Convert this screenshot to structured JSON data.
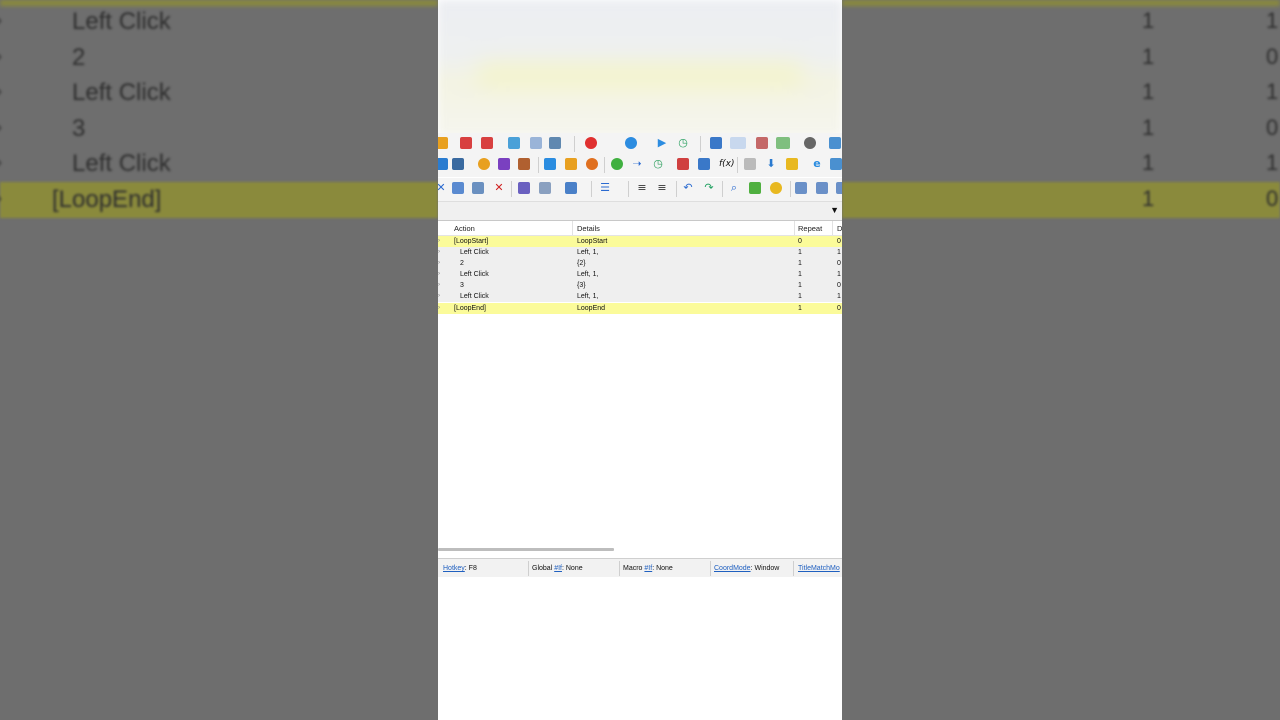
{
  "background_zoom": {
    "rows": [
      {
        "label": "Left Click",
        "repeat": "1",
        "extra": "1",
        "highlight": false
      },
      {
        "label": "2",
        "repeat": "1",
        "extra": "0",
        "highlight": false
      },
      {
        "label": "Left Click",
        "repeat": "1",
        "extra": "1",
        "highlight": false
      },
      {
        "label": "3",
        "repeat": "1",
        "extra": "0",
        "highlight": false
      },
      {
        "label": "Left Click",
        "repeat": "1",
        "extra": "1",
        "highlight": false
      },
      {
        "label": "[LoopEnd]",
        "repeat": "1",
        "extra": "0",
        "highlight": true
      }
    ]
  },
  "list": {
    "columns": {
      "action": "Action",
      "details": "Details",
      "repeat": "Repeat",
      "delay": "D"
    },
    "rows": [
      {
        "action": "[LoopStart]",
        "details": "LoopStart",
        "repeat": "0",
        "delay": "0",
        "highlight": true,
        "indent": false
      },
      {
        "action": "Left Click",
        "details": "Left, 1,",
        "repeat": "1",
        "delay": "1",
        "highlight": false,
        "indent": true
      },
      {
        "action": "2",
        "details": "{2}",
        "repeat": "1",
        "delay": "0",
        "highlight": false,
        "indent": true
      },
      {
        "action": "Left Click",
        "details": "Left, 1,",
        "repeat": "1",
        "delay": "1",
        "highlight": false,
        "indent": true
      },
      {
        "action": "3",
        "details": "{3}",
        "repeat": "1",
        "delay": "0",
        "highlight": false,
        "indent": true
      },
      {
        "action": "Left Click",
        "details": "Left, 1,",
        "repeat": "1",
        "delay": "1",
        "highlight": false,
        "indent": true
      },
      {
        "action": "[LoopEnd]",
        "details": "LoopEnd",
        "repeat": "1",
        "delay": "0",
        "highlight": true,
        "indent": false
      }
    ]
  },
  "status": {
    "hotkey_label": "Hotkey",
    "hotkey_value": ": F8",
    "global_label": "Global ",
    "global_link": "#If",
    "global_value": ": None",
    "macro_label": "Macro ",
    "macro_link": "#If",
    "macro_value": ": None",
    "coord_label": "CoordMode",
    "coord_value": ": Window",
    "title_label": "TitleMatchMo"
  },
  "colors": {
    "highlight": "#fbfb9a",
    "row_normal": "#efefef",
    "link": "#2060c0"
  },
  "toolbar_icons": {
    "row1": [
      "new-icon",
      "calendar-icon",
      "calendar-x-icon",
      "mouse-icon",
      "window-icon",
      "gear-icon",
      "record-icon",
      "play-icon",
      "play-icon",
      "timer-icon",
      "window-icon",
      "window-icon",
      "image-icon",
      "toggle-icon",
      "power-icon",
      "monitor-icon"
    ],
    "row2": [
      "window-icon",
      "calculator-icon",
      "pause-icon",
      "comment-icon",
      "hourglass-icon",
      "window-icon",
      "image-icon",
      "settings-icon",
      "loop-icon",
      "arrow-icon",
      "timer-icon",
      "flow-icon",
      "window-icon",
      "function-icon",
      "mail-icon",
      "download-icon",
      "folder-icon",
      "ie-icon",
      "monitor-icon"
    ],
    "row3": [
      "cut-icon",
      "copy-icon",
      "paste-icon",
      "delete-icon",
      "select-icon",
      "list-icon",
      "copy-icon",
      "list-icon",
      "align-icon",
      "align-icon",
      "undo-icon",
      "redo-icon",
      "search-icon",
      "comment-icon",
      "color-icon",
      "add-icon",
      "remove-icon",
      "window-icon"
    ]
  }
}
